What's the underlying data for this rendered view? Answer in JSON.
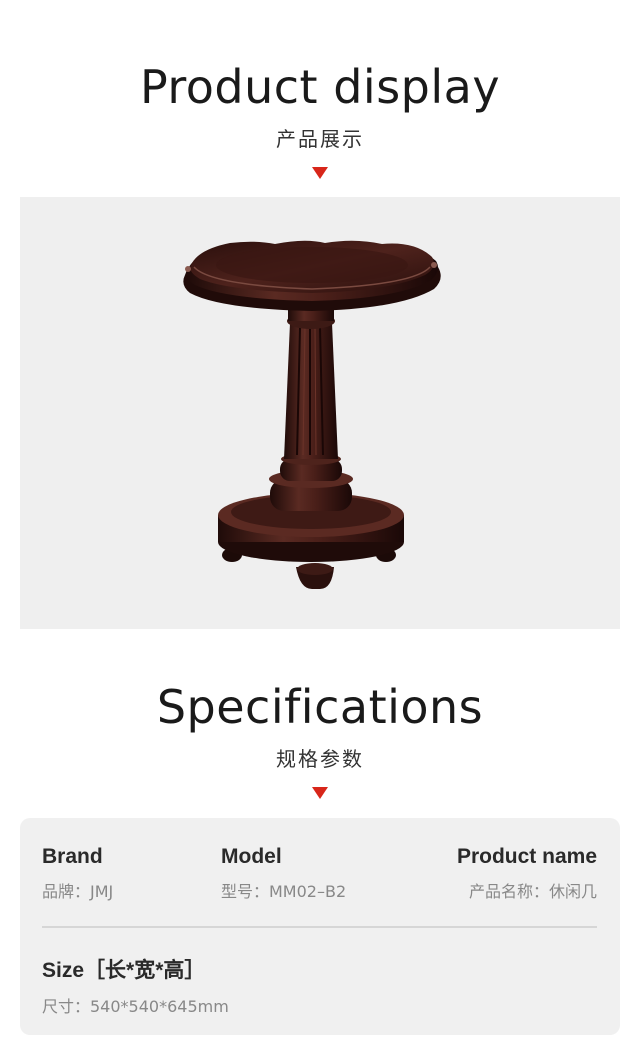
{
  "display": {
    "title": "Product display",
    "subtitle": "产品展示"
  },
  "specifications": {
    "title": "Specifications",
    "subtitle": "规格参数",
    "brand": {
      "label": "Brand",
      "value": "品牌：JMJ"
    },
    "model": {
      "label": "Model",
      "value": "型号：MM02–B2"
    },
    "product_name": {
      "label": "Product name",
      "value": "产品名称：休闲几"
    },
    "size": {
      "label": "Size［长*宽*高］",
      "value": "尺寸：540*540*645mm"
    }
  },
  "colors": {
    "accent_arrow": "#d8261a",
    "panel_background": "#efefef",
    "wood": "#3a1a16"
  },
  "icons": [
    "down-triangle-icon",
    "down-triangle-icon"
  ]
}
